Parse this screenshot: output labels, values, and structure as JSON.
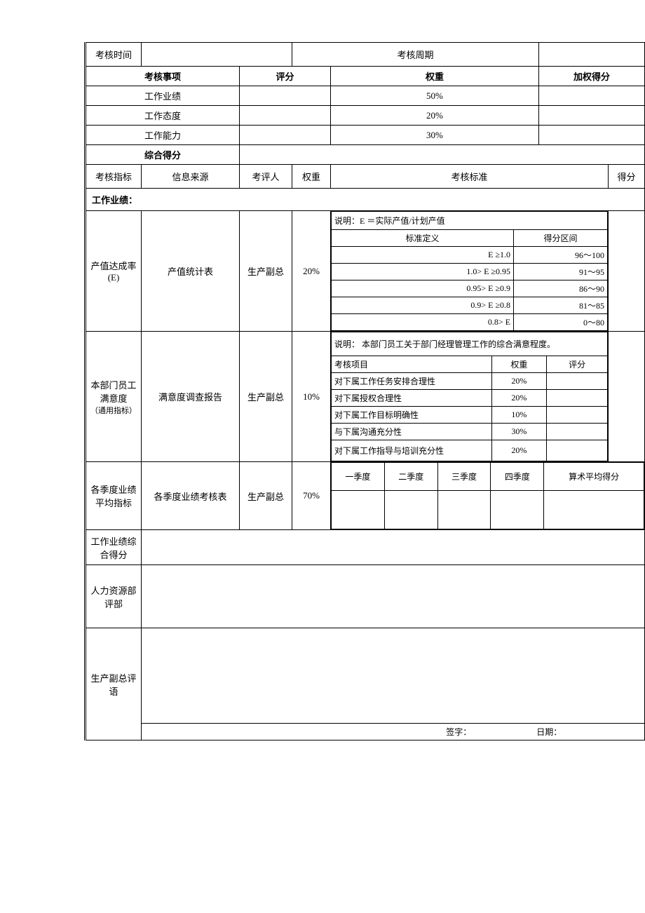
{
  "header": {
    "assess_time_label": "考核时间",
    "assess_period_label": "考核周期"
  },
  "summary": {
    "headers": {
      "item": "考核事项",
      "score": "评分",
      "weight": "权重",
      "weighted": "加权得分"
    },
    "rows": [
      {
        "item": "工作业绩",
        "weight": "50%"
      },
      {
        "item": "工作态度",
        "weight": "20%"
      },
      {
        "item": "工作能力",
        "weight": "30%"
      }
    ],
    "total_label": "综合得分"
  },
  "columns": {
    "indicator": "考核指标",
    "source": "信息来源",
    "assessor": "考评人",
    "weight": "权重",
    "standard": "考核标准",
    "score": "得分"
  },
  "section_performance": "工作业绩：",
  "row_e": {
    "indicator": "产值达成率(E)",
    "source": "产值统计表",
    "assessor": "生产副总",
    "weight": "20%",
    "desc": "说明：E ＝实际产值/计划产值",
    "def_header": "标准定义",
    "range_header": "得分区间",
    "levels": [
      {
        "def": "E ≥1.0",
        "range": "96～100"
      },
      {
        "def": "1.0> E ≥0.95",
        "range": "91～95"
      },
      {
        "def": "0.95> E ≥0.9",
        "range": "86～90"
      },
      {
        "def": "0.9> E ≥0.8",
        "range": "81～85"
      },
      {
        "def": "0.8> E",
        "range": "0～80"
      }
    ]
  },
  "row_sat": {
    "indicator_l1": "本部门员工满意度",
    "indicator_l2": "（通用指标）",
    "source": "满意度调查报告",
    "assessor": "生产副总",
    "weight": "10%",
    "desc": "说明： 本部门员工关于部门经理管理工作的综合满意程度。",
    "headers": {
      "item": "考核项目",
      "weight": "权重",
      "score": "评分"
    },
    "items": [
      {
        "item": "对下属工作任务安排合理性",
        "weight": "20%"
      },
      {
        "item": "对下属授权合理性",
        "weight": "20%"
      },
      {
        "item": "对下属工作目标明确性",
        "weight": "10%"
      },
      {
        "item": "与下属沟通充分性",
        "weight": "30%"
      },
      {
        "item": "对下属工作指导与培训充分性",
        "weight": "20%"
      }
    ]
  },
  "row_quarter": {
    "indicator": "各季度业绩平均指标",
    "source": "各季度业绩考核表",
    "assessor": "生产副总",
    "weight": "70%",
    "q1": "一季度",
    "q2": "二季度",
    "q3": "三季度",
    "q4": "四季度",
    "avg": "算术平均得分"
  },
  "row_perf_total": "工作业绩综合得分",
  "row_hr": "人力资源部评部",
  "row_vp": {
    "label": "生产副总评语",
    "sign": "签字：",
    "date": "日期："
  }
}
